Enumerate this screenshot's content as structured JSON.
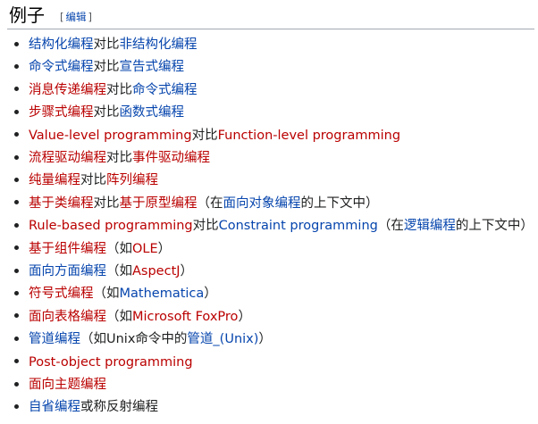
{
  "section": {
    "title": "例子",
    "edit_open": "[",
    "edit_label": "编辑",
    "edit_close": "]"
  },
  "items": [
    {
      "segments": [
        {
          "text": "结构化编程",
          "link": "blue"
        },
        {
          "text": "对比",
          "link": "plain"
        },
        {
          "text": "非结构化编程",
          "link": "blue"
        }
      ]
    },
    {
      "segments": [
        {
          "text": "命令式编程",
          "link": "blue"
        },
        {
          "text": "对比",
          "link": "plain"
        },
        {
          "text": "宣告式编程",
          "link": "blue"
        }
      ]
    },
    {
      "segments": [
        {
          "text": "消息传递编程",
          "link": "red"
        },
        {
          "text": "对比",
          "link": "plain"
        },
        {
          "text": "命令式编程",
          "link": "blue"
        }
      ]
    },
    {
      "segments": [
        {
          "text": "步骤式编程",
          "link": "red"
        },
        {
          "text": "对比",
          "link": "plain"
        },
        {
          "text": "函数式编程",
          "link": "blue"
        }
      ]
    },
    {
      "segments": [
        {
          "text": "Value-level programming",
          "link": "red"
        },
        {
          "text": "对比",
          "link": "plain"
        },
        {
          "text": "Function-level programming",
          "link": "red"
        }
      ]
    },
    {
      "segments": [
        {
          "text": "流程驱动编程",
          "link": "red"
        },
        {
          "text": "对比",
          "link": "plain"
        },
        {
          "text": "事件驱动编程",
          "link": "red"
        }
      ]
    },
    {
      "segments": [
        {
          "text": "纯量编程",
          "link": "red"
        },
        {
          "text": "对比",
          "link": "plain"
        },
        {
          "text": "阵列编程",
          "link": "red"
        }
      ]
    },
    {
      "segments": [
        {
          "text": "基于类编程",
          "link": "red"
        },
        {
          "text": "对比",
          "link": "plain"
        },
        {
          "text": "基于原型编程",
          "link": "red"
        },
        {
          "text": "（在",
          "link": "plain"
        },
        {
          "text": "面向对象编程",
          "link": "blue"
        },
        {
          "text": "的上下文中）",
          "link": "plain"
        }
      ]
    },
    {
      "segments": [
        {
          "text": "Rule-based programming",
          "link": "red"
        },
        {
          "text": "对比",
          "link": "plain"
        },
        {
          "text": "Constraint programming",
          "link": "blue"
        },
        {
          "text": "（在",
          "link": "plain"
        },
        {
          "text": "逻辑编程",
          "link": "blue"
        },
        {
          "text": "的上下文中）",
          "link": "plain"
        }
      ]
    },
    {
      "segments": [
        {
          "text": "基于组件编程",
          "link": "red"
        },
        {
          "text": "（如",
          "link": "plain"
        },
        {
          "text": "OLE",
          "link": "red"
        },
        {
          "text": "）",
          "link": "plain"
        }
      ]
    },
    {
      "segments": [
        {
          "text": "面向方面编程",
          "link": "blue"
        },
        {
          "text": "（如",
          "link": "plain"
        },
        {
          "text": "AspectJ",
          "link": "red"
        },
        {
          "text": "）",
          "link": "plain"
        }
      ]
    },
    {
      "segments": [
        {
          "text": "符号式编程",
          "link": "red"
        },
        {
          "text": "（如",
          "link": "plain"
        },
        {
          "text": "Mathematica",
          "link": "blue"
        },
        {
          "text": "）",
          "link": "plain"
        }
      ]
    },
    {
      "segments": [
        {
          "text": "面向表格编程",
          "link": "red"
        },
        {
          "text": "（如",
          "link": "plain"
        },
        {
          "text": "Microsoft FoxPro",
          "link": "red"
        },
        {
          "text": "）",
          "link": "plain"
        }
      ]
    },
    {
      "segments": [
        {
          "text": "管道编程",
          "link": "blue"
        },
        {
          "text": "（如Unix命令中的",
          "link": "plain"
        },
        {
          "text": "管道_(Unix)",
          "link": "blue"
        },
        {
          "text": "）",
          "link": "plain"
        }
      ]
    },
    {
      "segments": [
        {
          "text": "Post-object programming",
          "link": "red"
        }
      ]
    },
    {
      "segments": [
        {
          "text": "面向主题编程",
          "link": "red"
        }
      ]
    },
    {
      "segments": [
        {
          "text": "自省编程",
          "link": "blue"
        },
        {
          "text": "或称反射编程",
          "link": "plain"
        }
      ]
    }
  ]
}
